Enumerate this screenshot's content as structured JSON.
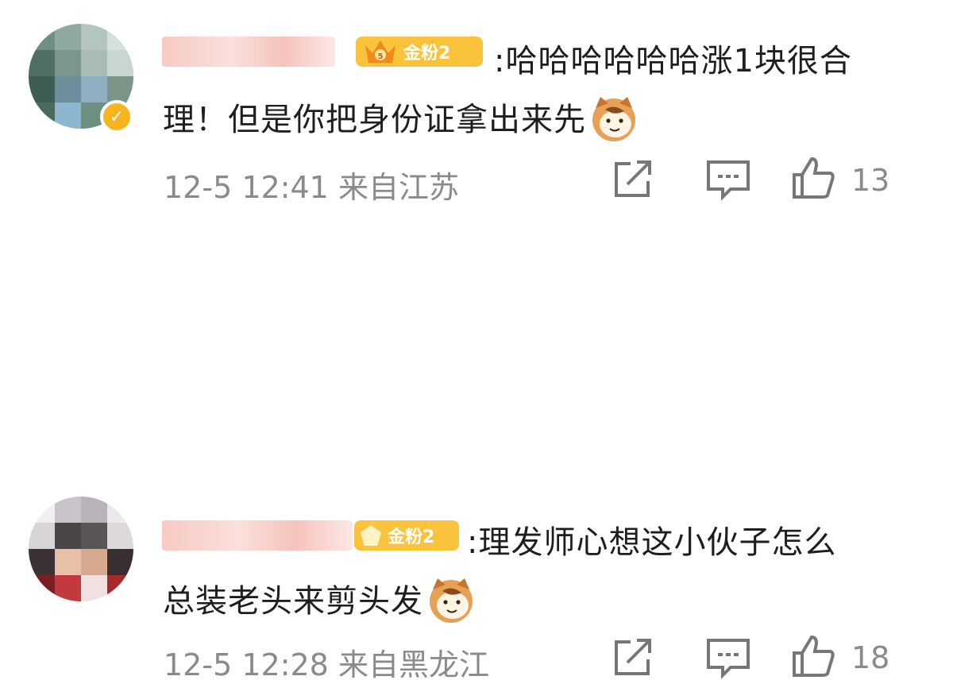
{
  "comments": [
    {
      "badge_label": "金粉2",
      "text_line1": ":哈哈哈哈哈哈涨1块很合",
      "text_line2": "理！但是你把身份证拿出来先",
      "time": "12-5 12:41",
      "location": "来自江苏",
      "like_count": "13",
      "verified": true
    },
    {
      "badge_label": "金粉2",
      "text_line1": ":理发师心想这小伙子怎么",
      "text_line2": "总装老头来剪头发",
      "time": "12-5 12:28",
      "location": "来自黑龙江",
      "like_count": "18",
      "verified": false
    }
  ],
  "icons": [
    "share-icon",
    "reply-icon",
    "like-icon",
    "cat-emoji-icon",
    "verified-icon",
    "crown-icon",
    "gem-icon"
  ],
  "colors": {
    "badge": "#fbc23c",
    "meta": "#8a8a8a",
    "verify": "#f5b51e"
  }
}
